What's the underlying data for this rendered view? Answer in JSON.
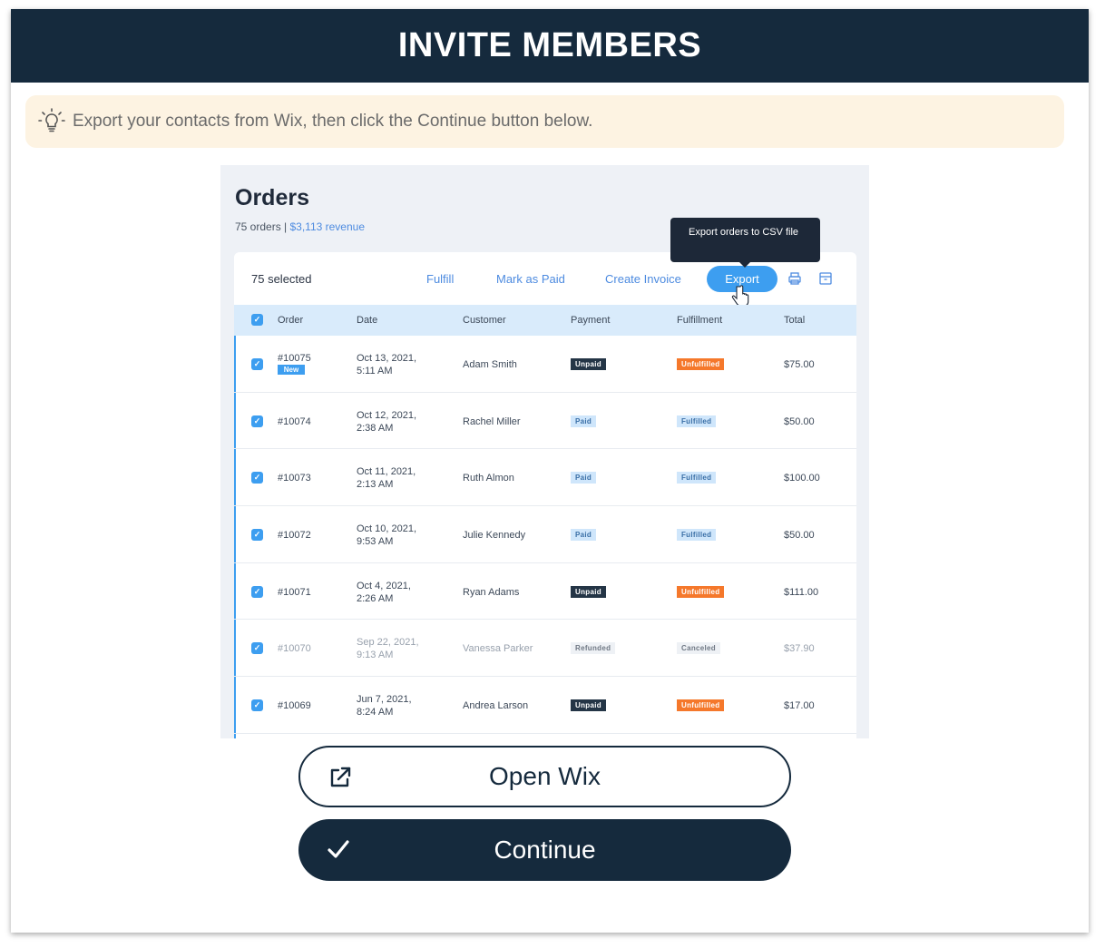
{
  "header": {
    "title": "INVITE MEMBERS"
  },
  "hint": {
    "text": "Export your contacts from Wix, then click the Continue button below.",
    "icon": "lightbulb-icon"
  },
  "orders": {
    "title": "Orders",
    "summary": "75 orders | ",
    "revenue": "$3,113 revenue",
    "tooltip": "Export orders to CSV file",
    "toolbar": {
      "selected": "75 selected",
      "fulfill": "Fulfill",
      "mark_paid": "Mark as Paid",
      "create_invoice": "Create Invoice",
      "export": "Export"
    },
    "columns": [
      "Order",
      "Date",
      "Customer",
      "Payment",
      "Fulfillment",
      "Total"
    ],
    "rows": [
      {
        "order": "#10075",
        "badge": "New",
        "date1": "Oct 13, 2021,",
        "date2": "5:11 AM",
        "customer": "Adam Smith",
        "payment": "Unpaid",
        "fulfillment": "Unfulfilled",
        "total": "$75.00"
      },
      {
        "order": "#10074",
        "date1": "Oct 12, 2021,",
        "date2": "2:38 AM",
        "customer": "Rachel Miller",
        "payment": "Paid",
        "fulfillment": "Fulfilled",
        "total": "$50.00"
      },
      {
        "order": "#10073",
        "date1": "Oct 11, 2021,",
        "date2": "2:13 AM",
        "customer": "Ruth Almon",
        "payment": "Paid",
        "fulfillment": "Fulfilled",
        "total": "$100.00"
      },
      {
        "order": "#10072",
        "date1": "Oct 10, 2021,",
        "date2": "9:53 AM",
        "customer": "Julie Kennedy",
        "payment": "Paid",
        "fulfillment": "Fulfilled",
        "total": "$50.00"
      },
      {
        "order": "#10071",
        "date1": "Oct 4, 2021,",
        "date2": "2:26 AM",
        "customer": "Ryan Adams",
        "payment": "Unpaid",
        "fulfillment": "Unfulfilled",
        "total": "$111.00"
      },
      {
        "order": "#10070",
        "date1": "Sep 22, 2021,",
        "date2": "9:13 AM",
        "customer": "Vanessa Parker",
        "payment": "Refunded",
        "fulfillment": "Canceled",
        "total": "$37.90"
      },
      {
        "order": "#10069",
        "date1": "Jun 7, 2021,",
        "date2": "8:24 AM",
        "customer": "Andrea Larson",
        "payment": "Unpaid",
        "fulfillment": "Unfulfilled",
        "total": "$17.00"
      }
    ]
  },
  "buttons": {
    "open_wix": "Open Wix",
    "continue": "Continue"
  },
  "colors": {
    "header": "#152a3d",
    "hint_bg": "#fdf3e2",
    "accent": "#3d9ef0"
  }
}
